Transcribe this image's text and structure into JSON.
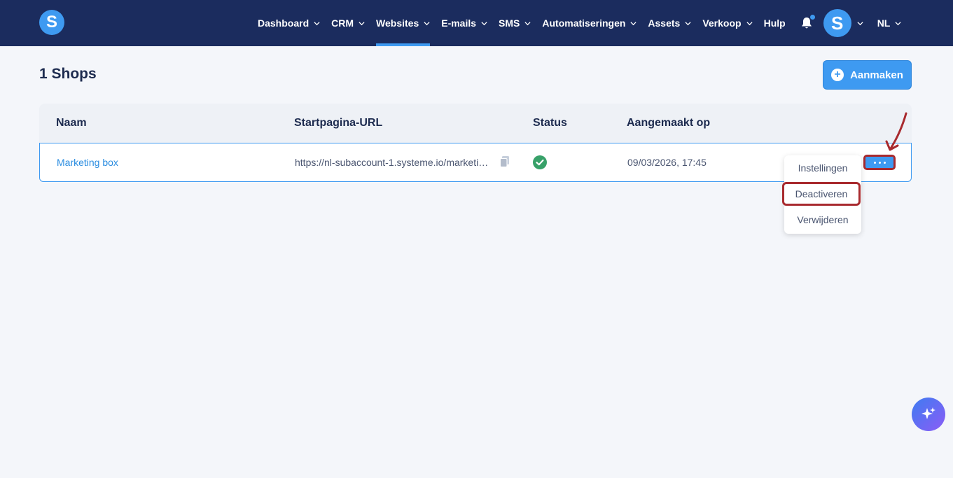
{
  "nav": {
    "logo": "S",
    "items": [
      {
        "label": "Dashboard",
        "has_chevron": true,
        "active": false
      },
      {
        "label": "CRM",
        "has_chevron": true,
        "active": false
      },
      {
        "label": "Websites",
        "has_chevron": true,
        "active": true
      },
      {
        "label": "E-mails",
        "has_chevron": true,
        "active": false
      },
      {
        "label": "SMS",
        "has_chevron": true,
        "active": false
      },
      {
        "label": "Automatiseringen",
        "has_chevron": true,
        "active": false
      },
      {
        "label": "Assets",
        "has_chevron": true,
        "active": false
      },
      {
        "label": "Verkoop",
        "has_chevron": true,
        "active": false
      },
      {
        "label": "Hulp",
        "has_chevron": false,
        "active": false
      }
    ],
    "avatar": "S",
    "language": "NL"
  },
  "page": {
    "title": "1 Shops",
    "create_label": "Aanmaken"
  },
  "table": {
    "headers": [
      "Naam",
      "Startpagina-URL",
      "Status",
      "Aangemaakt op"
    ],
    "rows": [
      {
        "name": "Marketing box",
        "url": "https://nl-subaccount-1.systeme.io/marketing-box",
        "status_icon": "check-circle-icon",
        "created": "09/03/2026, 17:45"
      }
    ]
  },
  "menu": {
    "items": [
      "Instellingen",
      "Deactiveren",
      "Verwijderen"
    ],
    "highlighted": "Deactiveren"
  },
  "colors": {
    "nav_bg": "#1b2c5e",
    "accent": "#3e9af1",
    "success": "#38a169",
    "annotation": "#a82a2e"
  }
}
